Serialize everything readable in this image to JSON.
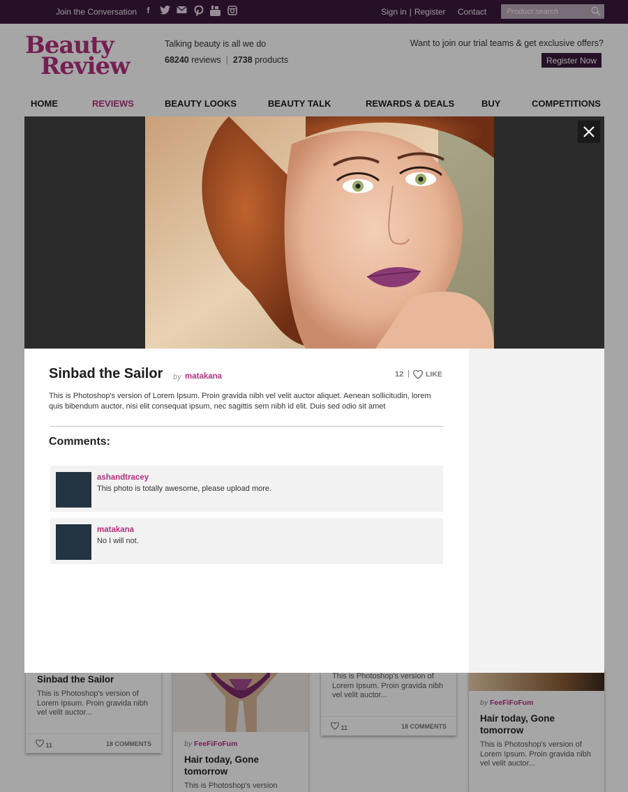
{
  "topbar": {
    "join": "Join the Conversation",
    "social_icons": [
      "facebook-icon",
      "twitter-icon",
      "mail-icon",
      "pinterest-icon",
      "youtube-icon",
      "instagram-icon"
    ],
    "sign_in": "Sign in",
    "separator": "|",
    "register": "Register",
    "contact": "Contact",
    "search_placeholder": "Product search"
  },
  "header": {
    "logo_line1": "Beauty",
    "logo_line2": "Review",
    "tagline": "Talking beauty is all we do",
    "reviews_count": "68240",
    "reviews_label": "reviews",
    "stats_sep": "|",
    "products_count": "2738",
    "products_label": "products",
    "offer": "Want to join our trial teams & get exclusive offers?",
    "register_now": "Register Now"
  },
  "nav": {
    "items": [
      "HOME",
      "REVIEWS",
      "BEAUTY LOOKS",
      "BEAUTY TALK",
      "REWARDS & DEALS",
      "BUY",
      "COMPETITIONS"
    ],
    "active": "REVIEWS"
  },
  "modal": {
    "title": "Sinbad the Sailor",
    "by": "by",
    "author": "matakana",
    "likes": "12",
    "sep": "|",
    "like_label": "LIKE",
    "description": "This is Photoshop's version  of Lorem Ipsum. Proin gravida nibh vel velit auctor aliquet. Aenean sollicitudin, lorem quis bibendum auctor, nisi elit consequat ipsum, nec sagittis sem nibh id elit. Duis sed odio sit amet",
    "comments_heading": "Comments:",
    "comments": [
      {
        "user": "ashandtracey",
        "text": "This photo is totally awesome, please upload more."
      },
      {
        "user": "matakana",
        "text": "No I will not."
      }
    ]
  },
  "cards": {
    "c1": {
      "title": "Sinbad the Sailor",
      "desc": "This is Photoshop's version of Lorem Ipsum. Proin gravida nibh vel velit auctor...",
      "likes": "11",
      "comments": "18 COMMENTS"
    },
    "c2": {
      "by": "by",
      "author": "FeeFiFoFum",
      "title": "Hair today, Gone tomorrow",
      "desc": "This is Photoshop's version"
    },
    "c3": {
      "desc": "This is Photoshop's version of Lorem Ipsum. Proin gravida nibh vel velit auctor...",
      "likes": "11",
      "comments": "18 COMMENTS"
    },
    "c4": {
      "by": "by",
      "author": "FeeFiFoFum",
      "title": "Hair today, Gone tomorrow",
      "desc": "This is Photoshop's version of Lorem Ipsum. Proin gravida nibh vel velit auctor..."
    }
  },
  "colors": {
    "brand": "#b2307f",
    "topbar": "#3a1a3c",
    "avatar": "#233340"
  }
}
